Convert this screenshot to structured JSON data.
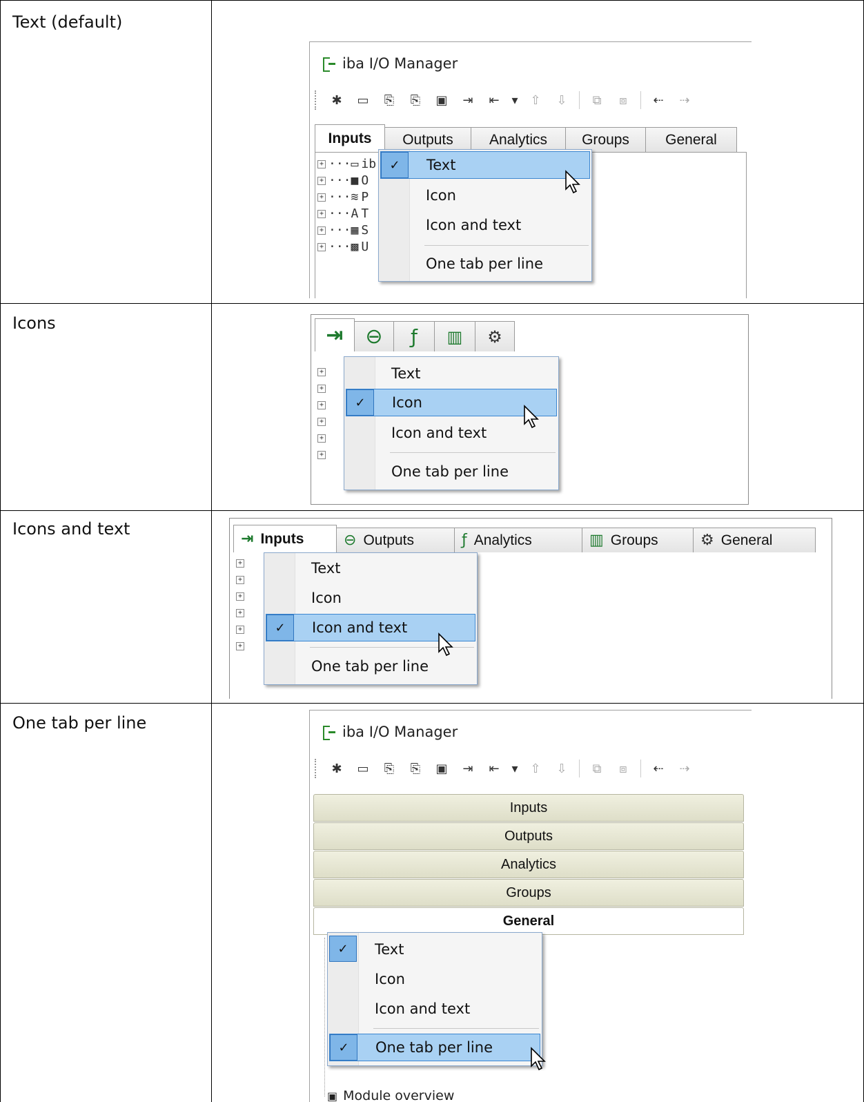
{
  "rows": [
    {
      "label": "Text (default)"
    },
    {
      "label": "Icons"
    },
    {
      "label": "Icons and text"
    },
    {
      "label": "One tab per line"
    }
  ],
  "window": {
    "title": "iba I/O Manager"
  },
  "tabs": {
    "inputs": "Inputs",
    "outputs": "Outputs",
    "analytics": "Analytics",
    "groups": "Groups",
    "general": "General"
  },
  "tree": {
    "row1": "ib",
    "row2": "O",
    "row3": "P",
    "row4": "T",
    "row5": "S",
    "row6": "U",
    "module_overview": "Module overview"
  },
  "menu": {
    "text": "Text",
    "icon": "Icon",
    "icon_and_text": "Icon and text",
    "one_tab_per_line": "One tab per line",
    "check": "✓"
  },
  "colors": {
    "menu_highlight": "#a9d1f3",
    "menu_border": "#3c86d0",
    "tab_icon": "#1e7a2e"
  }
}
